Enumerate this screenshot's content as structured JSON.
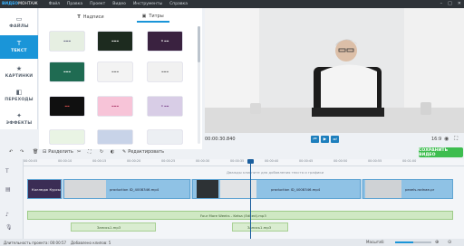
{
  "app": {
    "logo_prefix": "ВИДЕО",
    "logo_main": "МОНТАЖ"
  },
  "menu": [
    "Файл",
    "Правка",
    "Проект",
    "Видео",
    "Инструменты",
    "Справка"
  ],
  "sidebar": {
    "items": [
      {
        "label": "ФАЙЛЫ",
        "icon": "folder-icon"
      },
      {
        "label": "ТЕКСТ",
        "icon": "text-icon",
        "active": true
      },
      {
        "label": "КАРТИНКИ",
        "icon": "stickers-icon"
      },
      {
        "label": "ПЕРЕХОДЫ",
        "icon": "transitions-icon"
      },
      {
        "label": "ЭФФЕКТЫ",
        "icon": "effects-icon"
      }
    ]
  },
  "library": {
    "tabs": [
      {
        "label": "Надписи"
      },
      {
        "label": "Титры",
        "active": true
      }
    ]
  },
  "preview": {
    "time": "00:00:30.840",
    "aspect": "16:9"
  },
  "toolbar": {
    "split": "Разделить",
    "edit": "Редактировать",
    "export": "СОХРАНИТЬ ВИДЕО"
  },
  "timeline": {
    "ticks": [
      "00:00:05",
      "00:00:10",
      "00:00:15",
      "00:00:20",
      "00:00:25",
      "00:00:30",
      "00:00:35",
      "00:00:40",
      "00:00:45",
      "00:00:50",
      "00:00:55",
      "00:01:00"
    ],
    "text_hint": "Дважды кликните для добавления текста и графики",
    "clips": [
      "Колледж Курсы",
      "production ID_4008346.mp4",
      "production ID_4008346.mp4",
      "pexels-rodnae-pr"
    ],
    "music": "Four More Weeks - Ketsa (Edited).mp3",
    "recordings": [
      "Запись1.mp3",
      "Запись1.mp3"
    ]
  },
  "status": {
    "duration": "Длительность проекта: 00:00:57",
    "clips": "Добавлено клипов: 5",
    "zoom": "Масштаб:"
  },
  "colors": {
    "accent": "#1a95d8",
    "export": "#3dbd4f",
    "menubar": "#2e3338"
  }
}
